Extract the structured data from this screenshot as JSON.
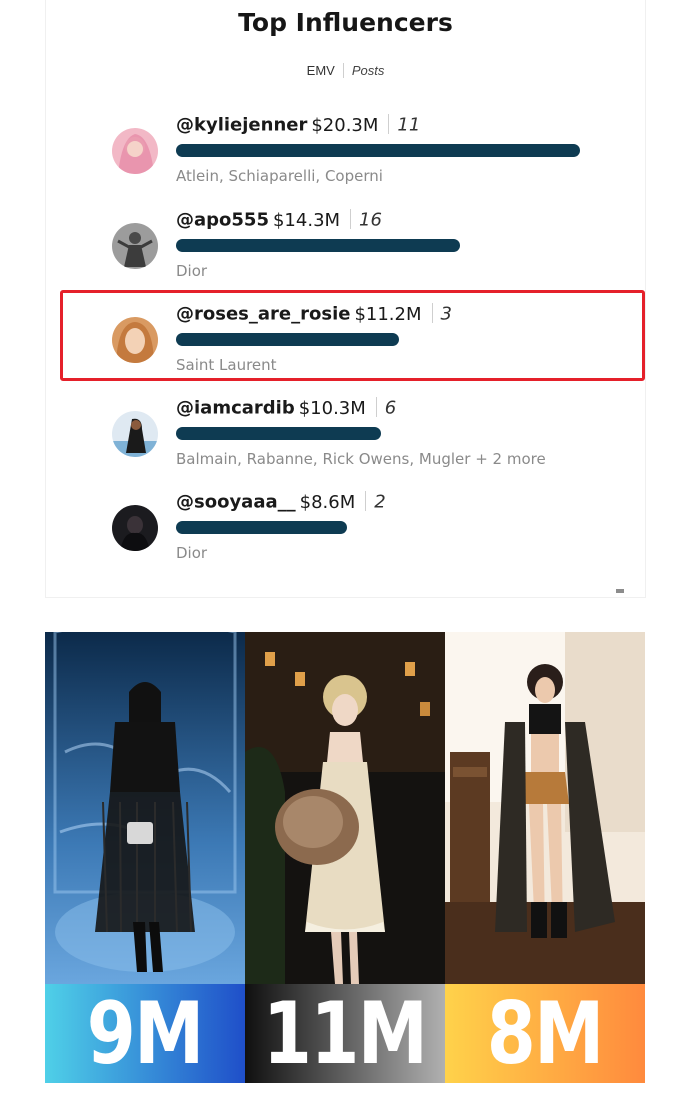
{
  "title": "Top Influencers",
  "metric_toggle": {
    "emv_label": "EMV",
    "posts_label": "Posts"
  },
  "influencers": [
    {
      "handle": "@kyliejenner",
      "emv": "$20.3M",
      "posts": "11",
      "brands": "Atlein, Schiaparelli, Coperni",
      "emv_fraction": 1.0,
      "highlighted": false,
      "avatar_icon": "avatar-kyliejenner"
    },
    {
      "handle": "@apo555",
      "emv": "$14.3M",
      "posts": "16",
      "brands": "Dior",
      "emv_fraction": 0.704,
      "highlighted": false,
      "avatar_icon": "avatar-apo555"
    },
    {
      "handle": "@roses_are_rosie",
      "emv": "$11.2M",
      "posts": "3",
      "brands": "Saint Laurent",
      "emv_fraction": 0.552,
      "highlighted": true,
      "avatar_icon": "avatar-roses-are-rosie"
    },
    {
      "handle": "@iamcardib",
      "emv": "$10.3M",
      "posts": "6",
      "brands": "Balmain, Rabanne, Rick Owens, Mugler + 2 more",
      "emv_fraction": 0.507,
      "highlighted": false,
      "avatar_icon": "avatar-iamcardib"
    },
    {
      "handle": "@sooyaaa__",
      "emv": "$8.6M",
      "posts": "2",
      "brands": "Dior",
      "emv_fraction": 0.424,
      "highlighted": false,
      "avatar_icon": "avatar-sooyaaa"
    }
  ],
  "colors": {
    "bar": "#0e3b52",
    "highlight_border": "#e5202a"
  },
  "photo_labels": [
    {
      "text": "9M",
      "band_colors": [
        "#4fd0e8",
        "#1f4fc9"
      ]
    },
    {
      "text": "11M",
      "band_colors": [
        "#101010",
        "#b0b0b0"
      ]
    },
    {
      "text": "8M",
      "band_colors": [
        "#ffd24a",
        "#ff8a3d"
      ]
    }
  ]
}
